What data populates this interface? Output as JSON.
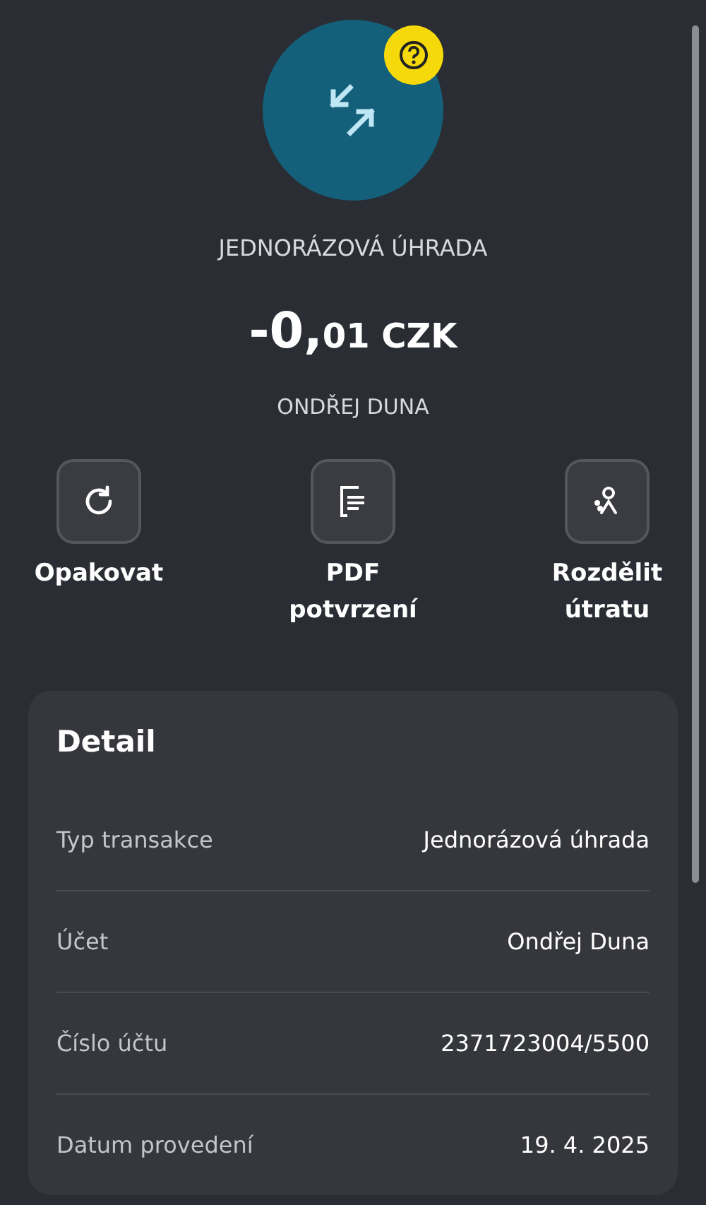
{
  "header": {
    "title": "JEDNORÁZOVÁ ÚHRADA",
    "amount_main": "-0,",
    "amount_minor": "01 CZK",
    "counterparty": "ONDŘEJ DUNA"
  },
  "actions": [
    {
      "kind": "repeat",
      "label": "Opakovat"
    },
    {
      "kind": "pdf",
      "label": "PDF potvrzení"
    },
    {
      "kind": "split",
      "label": "Rozdělit útratu"
    }
  ],
  "detail": {
    "title": "Detail",
    "rows": [
      {
        "label": "Typ transakce",
        "value": "Jednorázová úhrada"
      },
      {
        "label": "Účet",
        "value": "Ondřej Duna"
      },
      {
        "label": "Číslo účtu",
        "value": "2371723004/5500"
      },
      {
        "label": "Datum provedení",
        "value": "19. 4. 2025"
      }
    ]
  }
}
